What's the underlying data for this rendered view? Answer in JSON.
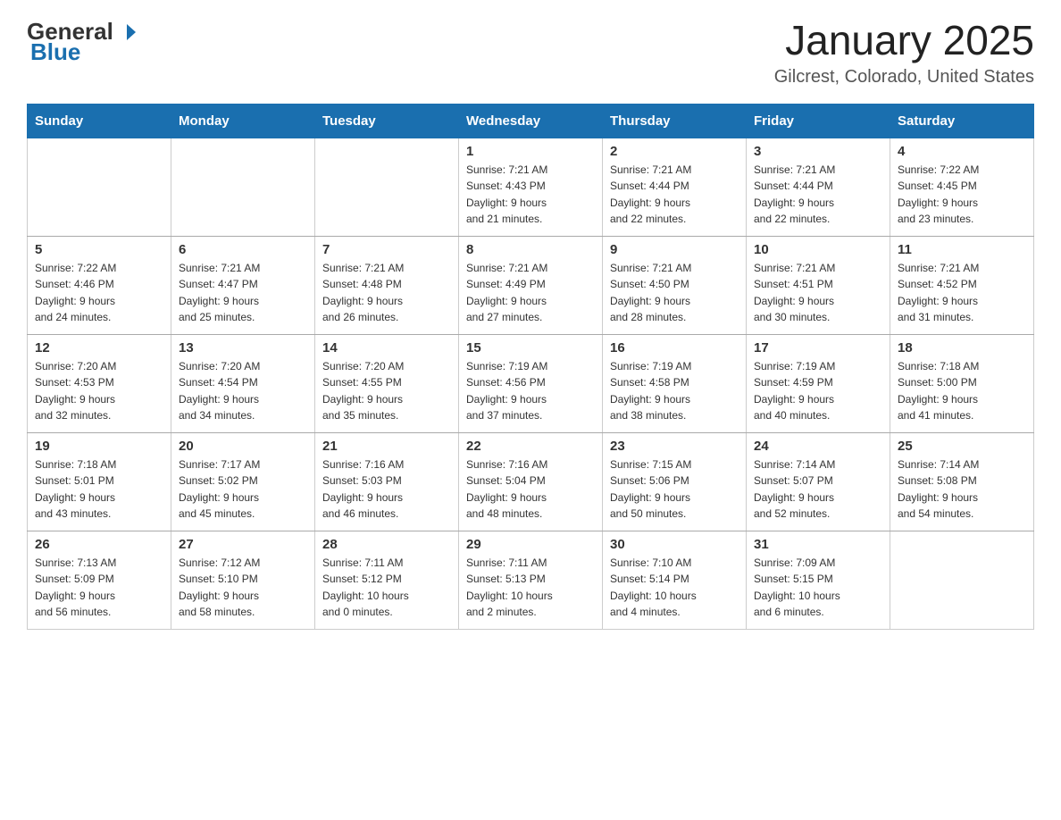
{
  "header": {
    "logo_general": "General",
    "logo_blue": "Blue",
    "title": "January 2025",
    "subtitle": "Gilcrest, Colorado, United States"
  },
  "weekdays": [
    "Sunday",
    "Monday",
    "Tuesday",
    "Wednesday",
    "Thursday",
    "Friday",
    "Saturday"
  ],
  "weeks": [
    [
      {
        "day": "",
        "info": ""
      },
      {
        "day": "",
        "info": ""
      },
      {
        "day": "",
        "info": ""
      },
      {
        "day": "1",
        "info": "Sunrise: 7:21 AM\nSunset: 4:43 PM\nDaylight: 9 hours\nand 21 minutes."
      },
      {
        "day": "2",
        "info": "Sunrise: 7:21 AM\nSunset: 4:44 PM\nDaylight: 9 hours\nand 22 minutes."
      },
      {
        "day": "3",
        "info": "Sunrise: 7:21 AM\nSunset: 4:44 PM\nDaylight: 9 hours\nand 22 minutes."
      },
      {
        "day": "4",
        "info": "Sunrise: 7:22 AM\nSunset: 4:45 PM\nDaylight: 9 hours\nand 23 minutes."
      }
    ],
    [
      {
        "day": "5",
        "info": "Sunrise: 7:22 AM\nSunset: 4:46 PM\nDaylight: 9 hours\nand 24 minutes."
      },
      {
        "day": "6",
        "info": "Sunrise: 7:21 AM\nSunset: 4:47 PM\nDaylight: 9 hours\nand 25 minutes."
      },
      {
        "day": "7",
        "info": "Sunrise: 7:21 AM\nSunset: 4:48 PM\nDaylight: 9 hours\nand 26 minutes."
      },
      {
        "day": "8",
        "info": "Sunrise: 7:21 AM\nSunset: 4:49 PM\nDaylight: 9 hours\nand 27 minutes."
      },
      {
        "day": "9",
        "info": "Sunrise: 7:21 AM\nSunset: 4:50 PM\nDaylight: 9 hours\nand 28 minutes."
      },
      {
        "day": "10",
        "info": "Sunrise: 7:21 AM\nSunset: 4:51 PM\nDaylight: 9 hours\nand 30 minutes."
      },
      {
        "day": "11",
        "info": "Sunrise: 7:21 AM\nSunset: 4:52 PM\nDaylight: 9 hours\nand 31 minutes."
      }
    ],
    [
      {
        "day": "12",
        "info": "Sunrise: 7:20 AM\nSunset: 4:53 PM\nDaylight: 9 hours\nand 32 minutes."
      },
      {
        "day": "13",
        "info": "Sunrise: 7:20 AM\nSunset: 4:54 PM\nDaylight: 9 hours\nand 34 minutes."
      },
      {
        "day": "14",
        "info": "Sunrise: 7:20 AM\nSunset: 4:55 PM\nDaylight: 9 hours\nand 35 minutes."
      },
      {
        "day": "15",
        "info": "Sunrise: 7:19 AM\nSunset: 4:56 PM\nDaylight: 9 hours\nand 37 minutes."
      },
      {
        "day": "16",
        "info": "Sunrise: 7:19 AM\nSunset: 4:58 PM\nDaylight: 9 hours\nand 38 minutes."
      },
      {
        "day": "17",
        "info": "Sunrise: 7:19 AM\nSunset: 4:59 PM\nDaylight: 9 hours\nand 40 minutes."
      },
      {
        "day": "18",
        "info": "Sunrise: 7:18 AM\nSunset: 5:00 PM\nDaylight: 9 hours\nand 41 minutes."
      }
    ],
    [
      {
        "day": "19",
        "info": "Sunrise: 7:18 AM\nSunset: 5:01 PM\nDaylight: 9 hours\nand 43 minutes."
      },
      {
        "day": "20",
        "info": "Sunrise: 7:17 AM\nSunset: 5:02 PM\nDaylight: 9 hours\nand 45 minutes."
      },
      {
        "day": "21",
        "info": "Sunrise: 7:16 AM\nSunset: 5:03 PM\nDaylight: 9 hours\nand 46 minutes."
      },
      {
        "day": "22",
        "info": "Sunrise: 7:16 AM\nSunset: 5:04 PM\nDaylight: 9 hours\nand 48 minutes."
      },
      {
        "day": "23",
        "info": "Sunrise: 7:15 AM\nSunset: 5:06 PM\nDaylight: 9 hours\nand 50 minutes."
      },
      {
        "day": "24",
        "info": "Sunrise: 7:14 AM\nSunset: 5:07 PM\nDaylight: 9 hours\nand 52 minutes."
      },
      {
        "day": "25",
        "info": "Sunrise: 7:14 AM\nSunset: 5:08 PM\nDaylight: 9 hours\nand 54 minutes."
      }
    ],
    [
      {
        "day": "26",
        "info": "Sunrise: 7:13 AM\nSunset: 5:09 PM\nDaylight: 9 hours\nand 56 minutes."
      },
      {
        "day": "27",
        "info": "Sunrise: 7:12 AM\nSunset: 5:10 PM\nDaylight: 9 hours\nand 58 minutes."
      },
      {
        "day": "28",
        "info": "Sunrise: 7:11 AM\nSunset: 5:12 PM\nDaylight: 10 hours\nand 0 minutes."
      },
      {
        "day": "29",
        "info": "Sunrise: 7:11 AM\nSunset: 5:13 PM\nDaylight: 10 hours\nand 2 minutes."
      },
      {
        "day": "30",
        "info": "Sunrise: 7:10 AM\nSunset: 5:14 PM\nDaylight: 10 hours\nand 4 minutes."
      },
      {
        "day": "31",
        "info": "Sunrise: 7:09 AM\nSunset: 5:15 PM\nDaylight: 10 hours\nand 6 minutes."
      },
      {
        "day": "",
        "info": ""
      }
    ]
  ]
}
